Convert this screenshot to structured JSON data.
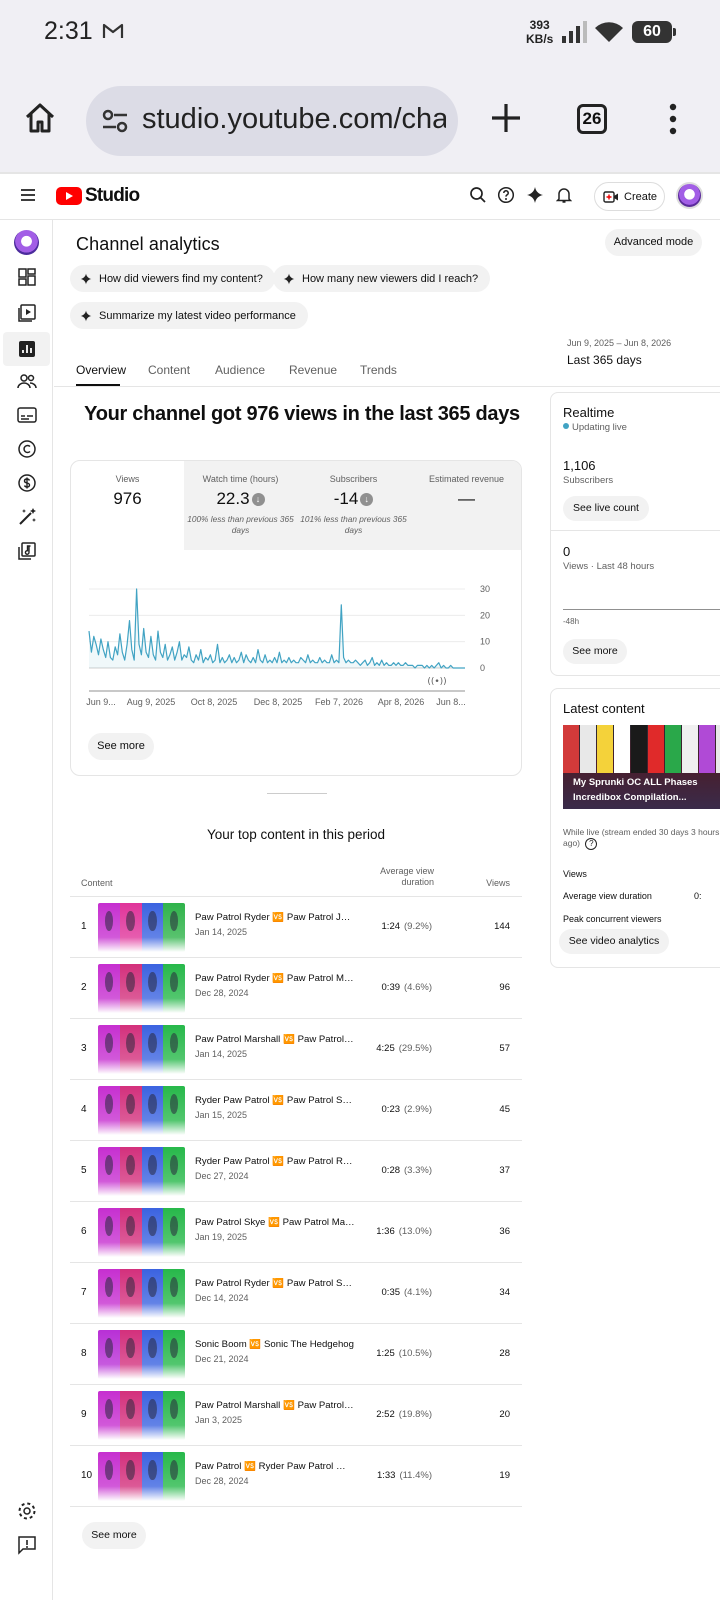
{
  "status_bar": {
    "time": "2:31",
    "net_speed_value": "393",
    "net_speed_unit": "KB/s",
    "battery": "60"
  },
  "browser": {
    "url": "studio.youtube.com/cha",
    "tab_count": "26"
  },
  "header": {
    "logo_text": "Studio",
    "create_label": "Create"
  },
  "page": {
    "title": "Channel analytics",
    "advanced_mode": "Advanced mode",
    "chips": [
      "How did viewers find my content?",
      "How many new viewers did I reach?",
      "Summarize my latest video performance"
    ],
    "tabs": [
      "Overview",
      "Content",
      "Audience",
      "Revenue",
      "Trends"
    ],
    "date_range": "Jun 9, 2025 – Jun 8, 2026",
    "date_label": "Last 365 days"
  },
  "overview": {
    "headline": "Your channel got 976 views in the last 365 days",
    "metrics": [
      {
        "label": "Views",
        "value": "976",
        "note": ""
      },
      {
        "label": "Watch time (hours)",
        "value": "22.3",
        "note": "100% less than previous 365 days"
      },
      {
        "label": "Subscribers",
        "value": "-14",
        "note": "101% less than previous 365 days"
      },
      {
        "label": "Estimated revenue",
        "value": "—",
        "note": ""
      }
    ],
    "see_more": "See more"
  },
  "chart_data": {
    "type": "line",
    "x_tick_labels": [
      "Jun 9...",
      "Aug 9, 2025",
      "Oct 8, 2025",
      "Dec 8, 2025",
      "Feb 7, 2026",
      "Apr 8, 2026",
      "Jun 8..."
    ],
    "y_tick_labels": [
      "30",
      "20",
      "10",
      "0"
    ],
    "ylim": [
      0,
      30
    ],
    "series": [
      {
        "values": [
          14,
          6,
          12,
          9,
          5,
          11,
          7,
          4,
          10,
          4,
          3,
          8,
          5,
          13,
          6,
          3,
          9,
          18,
          7,
          3,
          30,
          9,
          5,
          15,
          6,
          4,
          12,
          5,
          3,
          14,
          6,
          4,
          9,
          3,
          5,
          8,
          3,
          6,
          10,
          3,
          5,
          4,
          8,
          3,
          2,
          5,
          3,
          7,
          2,
          4,
          3,
          5,
          2,
          3,
          9,
          2,
          4,
          2,
          3,
          5,
          2,
          4,
          2,
          3,
          6,
          2,
          5,
          3,
          2,
          4,
          2,
          7,
          3,
          2,
          5,
          2,
          3,
          2,
          4,
          2,
          6,
          2,
          3,
          2,
          4,
          2,
          3,
          2,
          2,
          4,
          3,
          2,
          5,
          2,
          3,
          2,
          2,
          4,
          2,
          3,
          2,
          2,
          5,
          2,
          3,
          2,
          24,
          4,
          2,
          3,
          2,
          2,
          3,
          2,
          1,
          2,
          3,
          1,
          2,
          4,
          1,
          2,
          1,
          3,
          1,
          2,
          1,
          1,
          2,
          1,
          2,
          1,
          1,
          2,
          1,
          1,
          1,
          0,
          1,
          1,
          1,
          0,
          1,
          0,
          1,
          0,
          1,
          2,
          0,
          1,
          0,
          0,
          1,
          0,
          0,
          0,
          0,
          0,
          0
        ]
      }
    ],
    "grid": true,
    "legend": "none"
  },
  "top_content": {
    "title": "Your top content in this period",
    "col_content": "Content",
    "col_avd": "Average view duration",
    "col_views": "Views",
    "rows": [
      {
        "rank": "1",
        "title": "Paw Patrol Ryder 🆚 Paw Patrol Jake",
        "date": "Jan 14, 2025",
        "avd": "1:24",
        "pct": "(9.2%)",
        "views": "144"
      },
      {
        "rank": "2",
        "title": "Paw Patrol Ryder 🆚 Paw Patrol Marshall",
        "date": "Dec 28, 2024",
        "avd": "0:39",
        "pct": "(4.6%)",
        "views": "96"
      },
      {
        "rank": "3",
        "title": "Paw Patrol Marshall 🆚 Paw Patrol Chase",
        "date": "Jan 14, 2025",
        "avd": "4:25",
        "pct": "(29.5%)",
        "views": "57"
      },
      {
        "rank": "4",
        "title": "Ryder Paw Patrol 🆚 Paw Patrol Skye",
        "date": "Jan 15, 2025",
        "avd": "0:23",
        "pct": "(2.9%)",
        "views": "45"
      },
      {
        "rank": "5",
        "title": "Ryder Paw Patrol 🆚 Paw Patrol Ryder",
        "date": "Dec 27, 2024",
        "avd": "0:28",
        "pct": "(3.3%)",
        "views": "37"
      },
      {
        "rank": "6",
        "title": "Paw Patrol Skye 🆚 Paw Patrol Marshall",
        "date": "Jan 19, 2025",
        "avd": "1:36",
        "pct": "(13.0%)",
        "views": "36"
      },
      {
        "rank": "7",
        "title": "Paw Patrol Ryder 🆚 Paw Patrol Skye",
        "date": "Dec 14, 2024",
        "avd": "0:35",
        "pct": "(4.1%)",
        "views": "34"
      },
      {
        "rank": "8",
        "title": "Sonic Boom 🆚 Sonic The Hedgehog",
        "date": "Dec 21, 2024",
        "avd": "1:25",
        "pct": "(10.5%)",
        "views": "28"
      },
      {
        "rank": "9",
        "title": "Paw Patrol Marshall 🆚 Paw Patrol Chase",
        "date": "Jan 3, 2025",
        "avd": "2:52",
        "pct": "(19.8%)",
        "views": "20"
      },
      {
        "rank": "10",
        "title": "Paw Patrol 🆚 Ryder Paw Patrol 🆚 Chase",
        "date": "Dec 28, 2024",
        "avd": "1:33",
        "pct": "(11.4%)",
        "views": "19"
      }
    ],
    "see_more": "See more"
  },
  "realtime": {
    "title": "Realtime",
    "status": "Updating live",
    "subscribers_value": "1,106",
    "subscribers_label": "Subscribers",
    "see_live_count": "See live count",
    "views_value": "0",
    "views_label": "Views · Last 48 hours",
    "axis_left": "-48h",
    "axis_right": "N",
    "see_more": "See more"
  },
  "latest": {
    "title": "Latest content",
    "video_title": "My Sprunki OC ALL Phases Incredibox Compilation...",
    "live_note": "While live (stream ended 30 days 3 hours ago)",
    "rows": [
      "Views",
      "Average view duration",
      "Peak concurrent viewers"
    ],
    "avd_value": "0:",
    "see_video_analytics": "See video analytics"
  },
  "colors": {
    "accent_line": "#41a3c3",
    "youtube_red": "#ff0000",
    "chip_bg": "#f2f2f2",
    "vs_badge": "#f29c1f"
  }
}
